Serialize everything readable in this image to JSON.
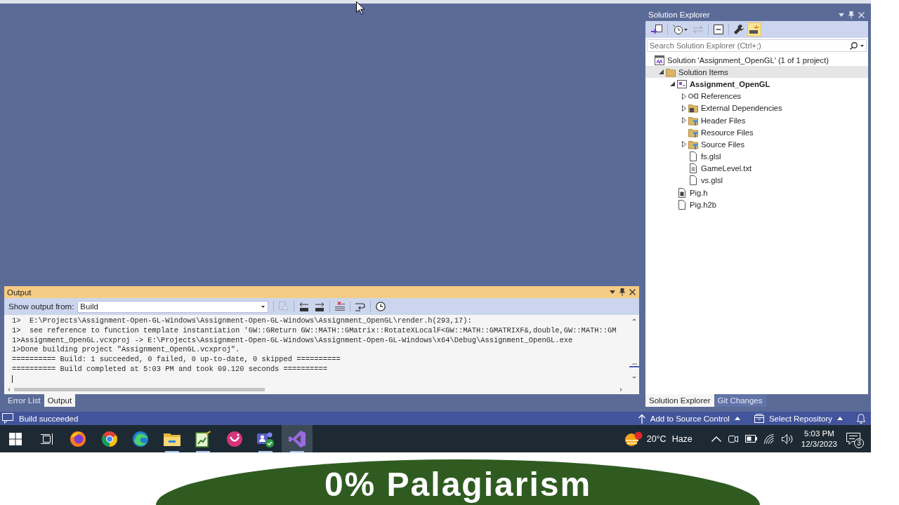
{
  "solution_explorer": {
    "title": "Solution Explorer",
    "toolbar": [
      {
        "kind": "sync",
        "on": false,
        "disabled": false
      },
      {
        "kind": "history",
        "on": false,
        "disabled": false
      },
      {
        "kind": "pending",
        "on": false,
        "disabled": true
      },
      {
        "kind": "collapse",
        "on": false,
        "disabled": false
      },
      {
        "kind": "properties",
        "on": false,
        "disabled": false
      },
      {
        "kind": "preview",
        "on": true,
        "disabled": false
      }
    ],
    "search": {
      "placeholder": "Search Solution Explorer (Ctrl+;)"
    },
    "tree": [
      {
        "label": "Solution 'Assignment_OpenGL' (1 of 1 project)",
        "kind": "solution",
        "selected": false,
        "children": [
          {
            "label": "Solution Items",
            "kind": "solution_folder",
            "expanded": true,
            "selected": true,
            "children": [
              {
                "label": "Assignment_OpenGL",
                "kind": "project",
                "expanded": true,
                "selected": false,
                "children": [
                  {
                    "label": "References",
                    "kind": "references",
                    "expanded": false,
                    "selected": false
                  },
                  {
                    "label": "External Dependencies",
                    "kind": "external",
                    "expanded": false,
                    "selected": false
                  },
                  {
                    "label": "Header Files",
                    "kind": "filter",
                    "expanded": false,
                    "selected": false
                  },
                  {
                    "label": "Resource Files",
                    "kind": "filter",
                    "selected": false
                  },
                  {
                    "label": "Source Files",
                    "kind": "filter",
                    "expanded": false,
                    "selected": false
                  },
                  {
                    "label": "fs.glsl",
                    "kind": "file",
                    "selected": false
                  },
                  {
                    "label": "GameLevel.txt",
                    "kind": "text_file",
                    "selected": false
                  },
                  {
                    "label": "vs.glsl",
                    "kind": "file",
                    "selected": false
                  }
                ]
              },
              {
                "label": "Pig.h",
                "kind": "header",
                "selected": false
              },
              {
                "label": "Pig.h2b",
                "kind": "file",
                "selected": false
              }
            ]
          }
        ]
      }
    ]
  },
  "explorer_tabs": [
    {
      "label": "Solution Explorer",
      "selected": true
    },
    {
      "label": "Git Changes",
      "selected": false
    }
  ],
  "output": {
    "title": "Output",
    "source_label": "Show output from:",
    "source": "Build",
    "toolbar": [
      {
        "kind": "find",
        "disabled": true
      },
      {
        "kind": "previous",
        "disabled": false
      },
      {
        "kind": "next",
        "disabled": false
      },
      {
        "kind": "clear",
        "disabled": false
      },
      {
        "kind": "wrap",
        "disabled": false
      },
      {
        "kind": "timestamps",
        "disabled": false
      }
    ],
    "lines": [
      "1>  E:\\Projects\\Assignment-Open-GL-Windows\\Assignment-Open-GL-Windows\\Assignment_OpenGL\\render.h(293,17):",
      "1>  see reference to function template instantiation 'GW::GReturn GW::MATH::GMatrix::RotateXLocalF<GW::MATH::GMATRIXF&,double,GW::MATH::GM",
      "1>Assignment_OpenGL.vcxproj -> E:\\Projects\\Assignment-Open-GL-Windows\\Assignment-Open-GL-Windows\\x64\\Debug\\Assignment_OpenGL.exe",
      "1>Done building project \"Assignment_OpenGL.vcxproj\".",
      "========== Build: 1 succeeded, 0 failed, 0 up-to-date, 0 skipped ==========",
      "========== Build completed at 5:03 PM and took 09.120 seconds =========="
    ]
  },
  "output_tabs": [
    {
      "label": "Error List",
      "selected": false
    },
    {
      "label": "Output",
      "selected": true
    }
  ],
  "status_bar": {
    "message": "Build succeeded",
    "items": [
      {
        "kind": "source_control",
        "label": "Add to Source Control"
      },
      {
        "kind": "repository",
        "label": "Select Repository"
      }
    ]
  },
  "taskbar": {
    "apps": [
      {
        "kind": "fox_browser",
        "running": false,
        "selected": false
      },
      {
        "kind": "ring_browser",
        "running": false,
        "selected": false
      },
      {
        "kind": "wave_browser",
        "running": false,
        "selected": false
      },
      {
        "kind": "folder",
        "running": true,
        "selected": false
      },
      {
        "kind": "chart_document",
        "running": true,
        "selected": false
      },
      {
        "kind": "disc_app",
        "running": false,
        "selected": false
      },
      {
        "kind": "chat_app",
        "running": true,
        "selected": false
      },
      {
        "kind": "ribbon_app",
        "running": true,
        "selected": true
      }
    ],
    "weather": {
      "temperature": "20°C",
      "condition": "Haze"
    },
    "time": "5:03 PM",
    "date": "12/3/2023",
    "notification_count": "3"
  },
  "banner": {
    "text": "0% Palagiarism"
  }
}
